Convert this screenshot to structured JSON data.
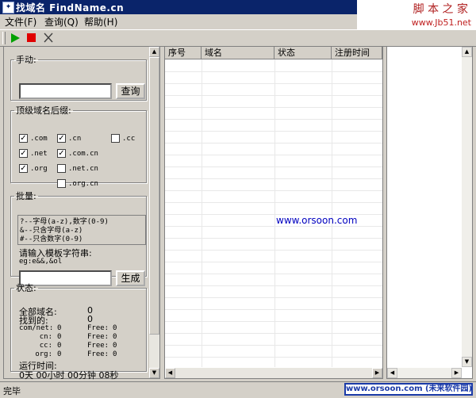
{
  "window": {
    "title": "找域名 FindName.cn"
  },
  "watermark": {
    "line1": "脚 本 之 家",
    "line2": "www.Jb51.net"
  },
  "menu": [
    "文件(F)",
    "查询(Q)",
    "帮助(H)"
  ],
  "manual": {
    "legend": "手动:",
    "input_value": "",
    "query_button": "查询"
  },
  "tld": {
    "legend": "顶级域名后缀:",
    "items": [
      {
        "label": ".com",
        "checked": true
      },
      {
        "label": ".cn",
        "checked": true
      },
      {
        "label": ".cc",
        "checked": false
      },
      {
        "label": ".net",
        "checked": true
      },
      {
        "label": ".com.cn",
        "checked": true
      },
      {
        "label": ".org",
        "checked": true
      },
      {
        "label": ".net.cn",
        "checked": false
      },
      {
        "label": ".org.cn",
        "checked": false
      }
    ]
  },
  "batch": {
    "legend": "批量:",
    "hints": [
      "?--字母(a-z),数字(0-9)",
      "&--只含字母(a-z)",
      "#--只含数字(0-9)"
    ],
    "template_label": "请输入模板字符串:",
    "example": "eg:e&&,&ol",
    "input_value": "",
    "generate_button": "生成"
  },
  "status": {
    "legend": "状态:",
    "total_label": "全部域名:",
    "total_value": "0",
    "found_label": "找到的:",
    "found_value": "0",
    "rows": [
      {
        "name": "com/net:",
        "val": "0",
        "free": "Free:",
        "fval": "0"
      },
      {
        "name": "cn:",
        "val": "0",
        "free": "Free:",
        "fval": "0"
      },
      {
        "name": "cc:",
        "val": "0",
        "free": "Free:",
        "fval": "0"
      },
      {
        "name": "org:",
        "val": "0",
        "free": "Free:",
        "fval": "0"
      }
    ],
    "runtime_label": "运行时间:",
    "runtime_value": "0天 00小时 00分钟 08秒"
  },
  "grid": {
    "columns": [
      "序号",
      "域名",
      "状态",
      "注册时间"
    ],
    "rows": []
  },
  "overlay_text": "www.orsoon.com",
  "statusbar": {
    "text": "完毕",
    "badge": "www.orsoon.com (未来软件园)"
  },
  "colors": {
    "titlebar": "#0a246a",
    "play": "#00a000",
    "stop": "#e00000",
    "link": "#0000c0"
  }
}
